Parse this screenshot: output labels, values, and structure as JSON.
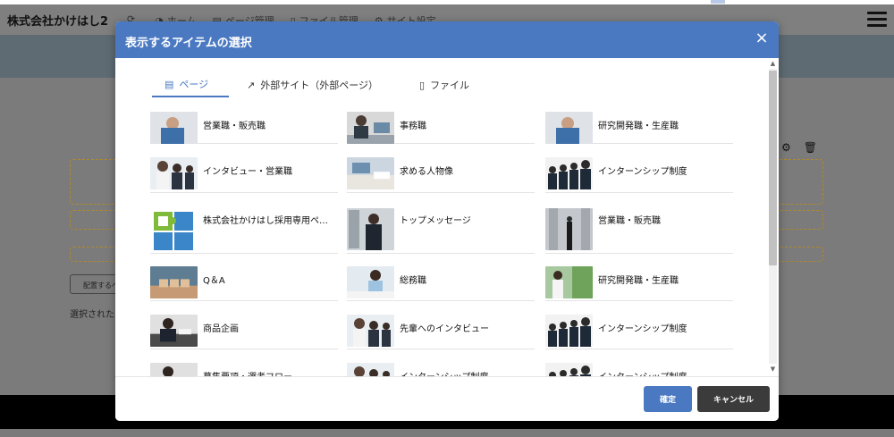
{
  "app": {
    "brand": "株式会社かけはし2",
    "nav": [
      {
        "icon": "refresh-icon",
        "glyph": "⟳",
        "label": ""
      },
      {
        "icon": "dashboard-icon",
        "glyph": "◕",
        "label": "ホーム"
      },
      {
        "icon": "page-icon",
        "glyph": "▤",
        "label": "ページ管理"
      },
      {
        "icon": "file-icon",
        "glyph": "▯",
        "label": "ファイル管理"
      },
      {
        "icon": "gear-icon",
        "glyph": "⚙",
        "label": "サイト設定"
      }
    ],
    "bg_button": "配置するペ",
    "bg_text": "選択された"
  },
  "modal": {
    "title": "表示するアイテムの選択",
    "close": "×",
    "tabs": [
      {
        "icon": "page-icon",
        "glyph": "▤",
        "label": "ページ",
        "active": true
      },
      {
        "icon": "external-link-icon",
        "glyph": "↗",
        "label": "外部サイト（外部ページ）",
        "active": false
      },
      {
        "icon": "file-icon",
        "glyph": "▯",
        "label": "ファイル",
        "active": false
      }
    ],
    "items": [
      {
        "label": "営業職・販売職",
        "thumb": "worker"
      },
      {
        "label": "事務職",
        "thumb": "office"
      },
      {
        "label": "研究開発職・生産職",
        "thumb": "worker"
      },
      {
        "label": "インタビュー・営業職",
        "thumb": "team"
      },
      {
        "label": "求める人物像",
        "thumb": "desk"
      },
      {
        "label": "インターンシップ制度",
        "thumb": "line"
      },
      {
        "label": "株式会社かけはし採用専用ペ…",
        "thumb": "puzzle"
      },
      {
        "label": "トップメッセージ",
        "thumb": "exec"
      },
      {
        "label": "営業職・販売職",
        "thumb": "city"
      },
      {
        "label": "Q＆A",
        "thumb": "blocks"
      },
      {
        "label": "総務職",
        "thumb": "lady"
      },
      {
        "label": "研究開発職・生産職",
        "thumb": "green"
      },
      {
        "label": "商品企画",
        "thumb": "desk2"
      },
      {
        "label": "先輩へのインタビュー",
        "thumb": "team"
      },
      {
        "label": "インターンシップ制度",
        "thumb": "line"
      },
      {
        "label": "募集要項・選考フロー",
        "thumb": "desk2"
      },
      {
        "label": "インターンシップ制度",
        "thumb": "team"
      },
      {
        "label": "インターンシップ制度",
        "thumb": "line"
      }
    ],
    "ok_label": "確定",
    "cancel_label": "キャンセル"
  }
}
